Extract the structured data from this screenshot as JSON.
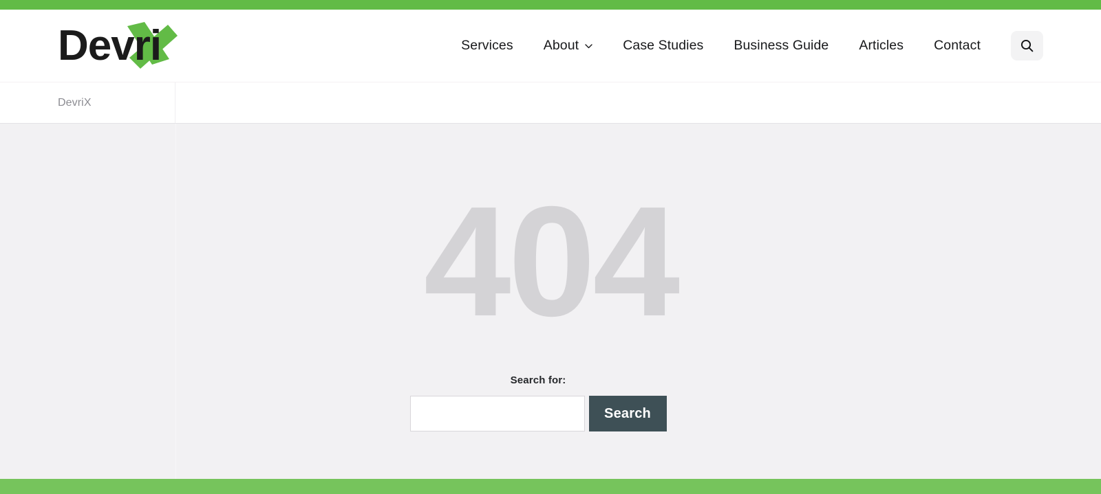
{
  "theme": {
    "green_top": "#62bb46",
    "green_bottom": "#76c45c",
    "page_bg": "#f2f1f3",
    "button_dark": "#3e5056",
    "error_gray": "#d4d3d6",
    "nav_text": "#17181a",
    "crumb_text": "#8c8c92"
  },
  "header": {
    "logo": {
      "text": "Devri",
      "mark": "X",
      "alt": "DevriX"
    },
    "nav": [
      {
        "label": "Services",
        "has_dropdown": false
      },
      {
        "label": "About",
        "has_dropdown": true
      },
      {
        "label": "Case Studies",
        "has_dropdown": false
      },
      {
        "label": "Business Guide",
        "has_dropdown": false
      },
      {
        "label": "Articles",
        "has_dropdown": false
      },
      {
        "label": "Contact",
        "has_dropdown": false
      }
    ],
    "search_icon": "search-icon"
  },
  "breadcrumb": {
    "items": [
      {
        "label": "DevriX"
      }
    ]
  },
  "main": {
    "error_code": "404",
    "search": {
      "label": "Search for:",
      "value": "",
      "placeholder": "",
      "button_label": "Search"
    }
  }
}
